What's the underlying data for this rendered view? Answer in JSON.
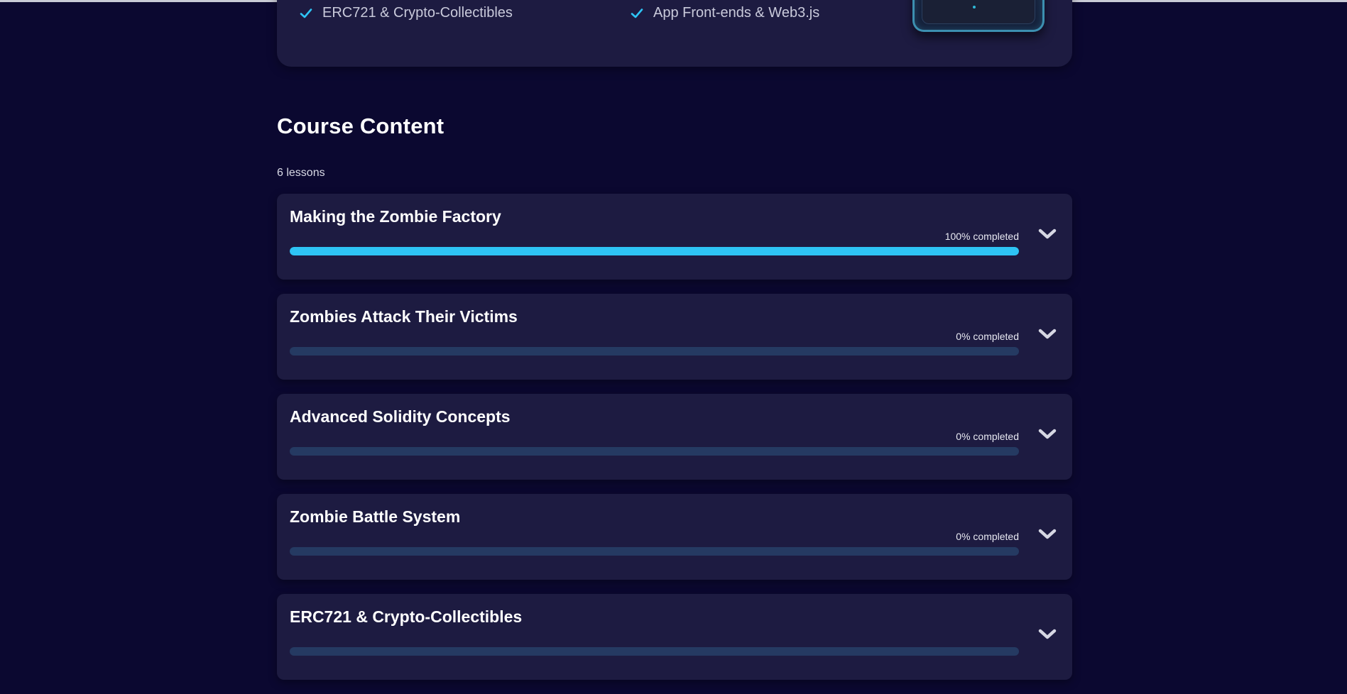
{
  "summary": {
    "features": [
      "ERC721 & Crypto-Collectibles",
      "App Front-ends & Web3.js"
    ]
  },
  "course_content": {
    "title": "Course Content",
    "lesson_count": "6 lessons",
    "lessons": [
      {
        "title": "Making the Zombie Factory",
        "progress_label": "100% completed",
        "progress": 1.0
      },
      {
        "title": "Zombies Attack Their Victims",
        "progress_label": "0% completed",
        "progress": 0.0
      },
      {
        "title": "Advanced Solidity Concepts",
        "progress_label": "0% completed",
        "progress": 0.0
      },
      {
        "title": "Zombie Battle System",
        "progress_label": "0% completed",
        "progress": 0.0
      },
      {
        "title": "ERC721 & Crypto-Collectibles",
        "progress_label": "",
        "progress": 0.0
      }
    ]
  },
  "icons": {
    "check": "check-icon",
    "chevron": "chevron-down-icon"
  },
  "colors": {
    "background": "#0b0830",
    "card": "#1d1b41",
    "accent": "#2ec4f5",
    "track": "#253a62"
  }
}
